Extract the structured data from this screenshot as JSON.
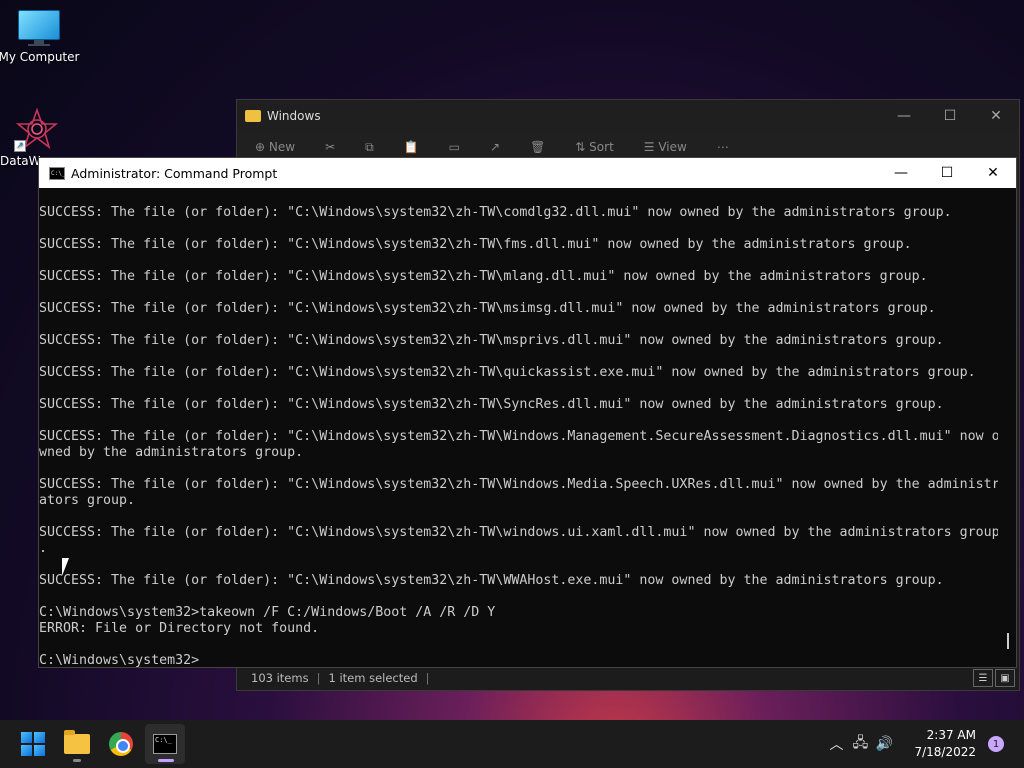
{
  "desktop": {
    "icons": [
      {
        "label": "My Computer"
      },
      {
        "label": "DataW"
      }
    ]
  },
  "explorer": {
    "title": "Windows",
    "toolbar": {
      "new_label": "New",
      "sort_label": "Sort",
      "view_label": "View"
    },
    "status": {
      "items_count": "103 items",
      "selected": "1 item selected"
    }
  },
  "cmd": {
    "title": "Administrator: Command Prompt",
    "lines": [
      "SUCCESS: The file (or folder): \"C:\\Windows\\system32\\zh-TW\\comdlg32.dll.mui\" now owned by the administrators group.",
      "",
      "SUCCESS: The file (or folder): \"C:\\Windows\\system32\\zh-TW\\fms.dll.mui\" now owned by the administrators group.",
      "",
      "SUCCESS: The file (or folder): \"C:\\Windows\\system32\\zh-TW\\mlang.dll.mui\" now owned by the administrators group.",
      "",
      "SUCCESS: The file (or folder): \"C:\\Windows\\system32\\zh-TW\\msimsg.dll.mui\" now owned by the administrators group.",
      "",
      "SUCCESS: The file (or folder): \"C:\\Windows\\system32\\zh-TW\\msprivs.dll.mui\" now owned by the administrators group.",
      "",
      "SUCCESS: The file (or folder): \"C:\\Windows\\system32\\zh-TW\\quickassist.exe.mui\" now owned by the administrators group.",
      "",
      "SUCCESS: The file (or folder): \"C:\\Windows\\system32\\zh-TW\\SyncRes.dll.mui\" now owned by the administrators group.",
      "",
      "SUCCESS: The file (or folder): \"C:\\Windows\\system32\\zh-TW\\Windows.Management.SecureAssessment.Diagnostics.dll.mui\" now o",
      "wned by the administrators group.",
      "",
      "SUCCESS: The file (or folder): \"C:\\Windows\\system32\\zh-TW\\Windows.Media.Speech.UXRes.dll.mui\" now owned by the administr",
      "ators group.",
      "",
      "SUCCESS: The file (or folder): \"C:\\Windows\\system32\\zh-TW\\windows.ui.xaml.dll.mui\" now owned by the administrators group",
      ".",
      "",
      "SUCCESS: The file (or folder): \"C:\\Windows\\system32\\zh-TW\\WWAHost.exe.mui\" now owned by the administrators group.",
      "",
      "C:\\Windows\\system32>takeown /F C:/Windows/Boot /A /R /D Y",
      "ERROR: File or Directory not found.",
      "",
      "C:\\Windows\\system32>"
    ]
  },
  "taskbar": {
    "apps": [
      "start-icon",
      "file-explorer-icon",
      "chrome-icon",
      "terminal-icon"
    ],
    "clock": {
      "time": "2:37 AM",
      "date": "7/18/2022"
    },
    "notification_count": "1"
  }
}
